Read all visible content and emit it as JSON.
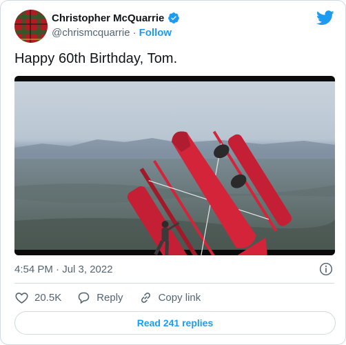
{
  "author": {
    "display_name": "Christopher McQuarrie",
    "handle": "@chrismcquarrie",
    "separator": "·",
    "follow_label": "Follow",
    "verified": true
  },
  "tweet": {
    "text": "Happy 60th Birthday, Tom.",
    "timestamp": "4:54 PM · Jul 3, 2022"
  },
  "actions": {
    "likes": "20.5K",
    "reply_label": "Reply",
    "copy_link_label": "Copy link"
  },
  "replies_button": {
    "label": "Read 241 replies"
  },
  "icons": {
    "brand": "twitter-bird-icon",
    "verified": "verified-badge-icon",
    "info": "info-icon",
    "like": "heart-icon",
    "reply": "reply-bubble-icon",
    "copy": "link-icon"
  },
  "colors": {
    "accent": "#1d9bf0",
    "text": "#0f1419",
    "muted": "#536471",
    "border": "#cfd9de",
    "plane": "#d3243a"
  }
}
